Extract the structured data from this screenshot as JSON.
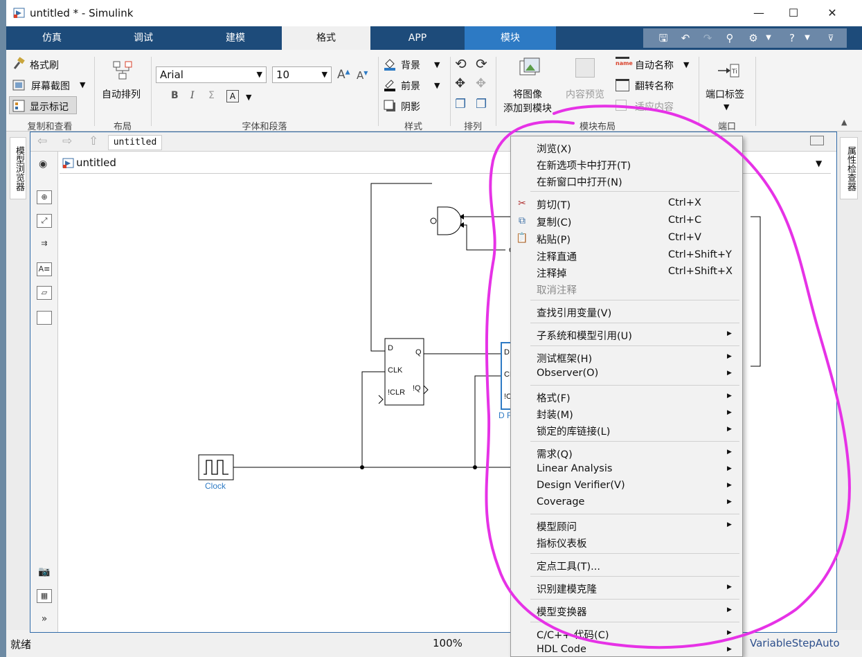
{
  "window": {
    "title": "untitled * - Simulink",
    "minimize": "—",
    "maximize": "☐",
    "close": "✕"
  },
  "tabs": [
    "仿真",
    "调试",
    "建模",
    "格式",
    "APP",
    "模块"
  ],
  "ribbon": {
    "copy_view": {
      "format_painter": "格式刷",
      "screenshot": "屏幕截图",
      "show_markers": "显示标记",
      "section": "复制和查看"
    },
    "layout": {
      "auto_arrange": "自动排列",
      "section": "布局"
    },
    "font": {
      "font_name": "Arial",
      "font_size": "10",
      "section": "字体和段落"
    },
    "style": {
      "background": "背景",
      "foreground": "前景",
      "shadow": "阴影",
      "section": "样式"
    },
    "arrange": {
      "section": "排列"
    },
    "block_layout": {
      "add_image_1": "将图像",
      "add_image_2": "添加到模块",
      "content_preview": "内容预览",
      "auto_name": "自动名称",
      "flip_name": "翻转名称",
      "fit_content": "适应内容",
      "section": "模块布局"
    },
    "port": {
      "port_label": "端口标签",
      "section": "端口"
    }
  },
  "side": {
    "left_label": "模型浏览器",
    "right_label": "属性检查器"
  },
  "editor": {
    "tab": "untitled",
    "path": "untitled"
  },
  "blocks": {
    "dff1": {
      "d": "D",
      "q": "Q",
      "clk": "CLK",
      "clr": "!CLR",
      "nq": "!Q"
    },
    "dff2": {
      "d": "D",
      "clk": "CLK",
      "clr": "!CL",
      "name": "D Fl"
    },
    "clock": {
      "name": "Clock"
    }
  },
  "status": {
    "ready": "就绪",
    "zoom": "100%",
    "solver": "VariableStepAuto"
  },
  "context_menu": [
    {
      "label": "浏览(X)"
    },
    {
      "label": "在新选项卡中打开(T)"
    },
    {
      "label": "在新窗口中打开(N)"
    },
    {
      "label": "剪切(T)",
      "shortcut": "Ctrl+X"
    },
    {
      "label": "复制(C)",
      "shortcut": "Ctrl+C"
    },
    {
      "label": "粘贴(P)",
      "shortcut": "Ctrl+V"
    },
    {
      "label": "注释直通",
      "shortcut": "Ctrl+Shift+Y"
    },
    {
      "label": "注释掉",
      "shortcut": "Ctrl+Shift+X"
    },
    {
      "label": "取消注释"
    },
    {
      "label": "查找引用变量(V)"
    },
    {
      "label": "子系统和模型引用(U)"
    },
    {
      "label": "测试框架(H)"
    },
    {
      "label": "Observer(O)"
    },
    {
      "label": "格式(F)"
    },
    {
      "label": "封装(M)"
    },
    {
      "label": "锁定的库链接(L)"
    },
    {
      "label": "需求(Q)"
    },
    {
      "label": "Linear Analysis"
    },
    {
      "label": "Design Verifier(V)"
    },
    {
      "label": "Coverage"
    },
    {
      "label": "模型顾问"
    },
    {
      "label": "指标仪表板"
    },
    {
      "label": "定点工具(T)..."
    },
    {
      "label": "识别建模克隆"
    },
    {
      "label": "模型变换器"
    },
    {
      "label": "C/C++ 代码(C)"
    },
    {
      "label": "HDL Code"
    }
  ]
}
